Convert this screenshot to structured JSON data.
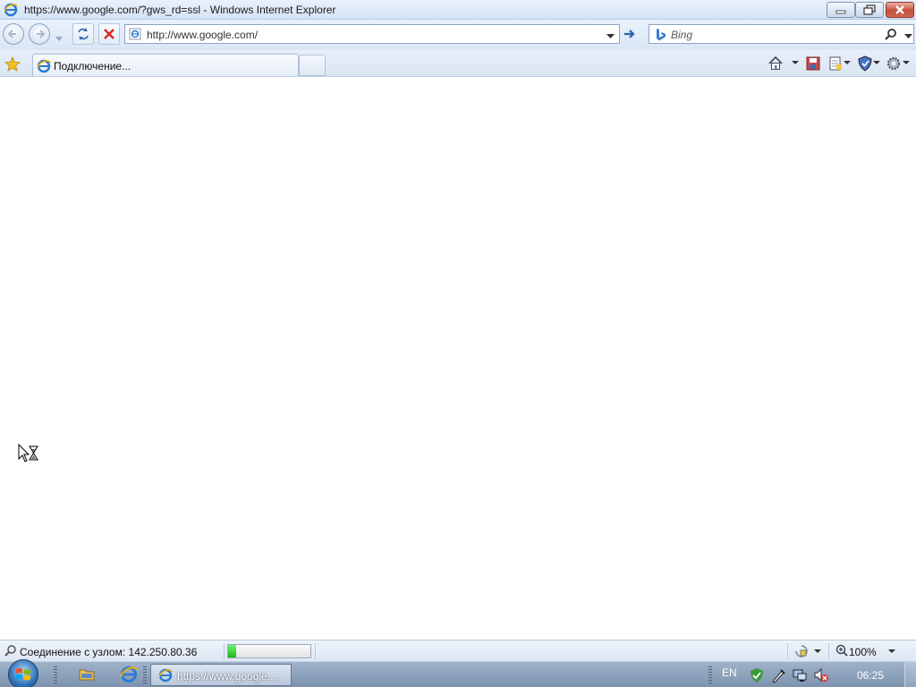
{
  "window": {
    "title": "https://www.google.com/?gws_rd=ssl - Windows Internet Explorer"
  },
  "navbar": {
    "address": "http://www.google.com/",
    "search_placeholder": "Bing"
  },
  "tabs": [
    {
      "label": "Подключение..."
    }
  ],
  "statusbar": {
    "text": "Соединение с узлом: 142.250.80.36",
    "progress": 0.1,
    "zoom": "100%"
  },
  "taskbar": {
    "active_item": "https://www.google....",
    "language": "EN",
    "clock": "06:25"
  },
  "colors": {
    "accent": "#2f72b8",
    "progress": "#16b916",
    "close": "#c24d39"
  }
}
